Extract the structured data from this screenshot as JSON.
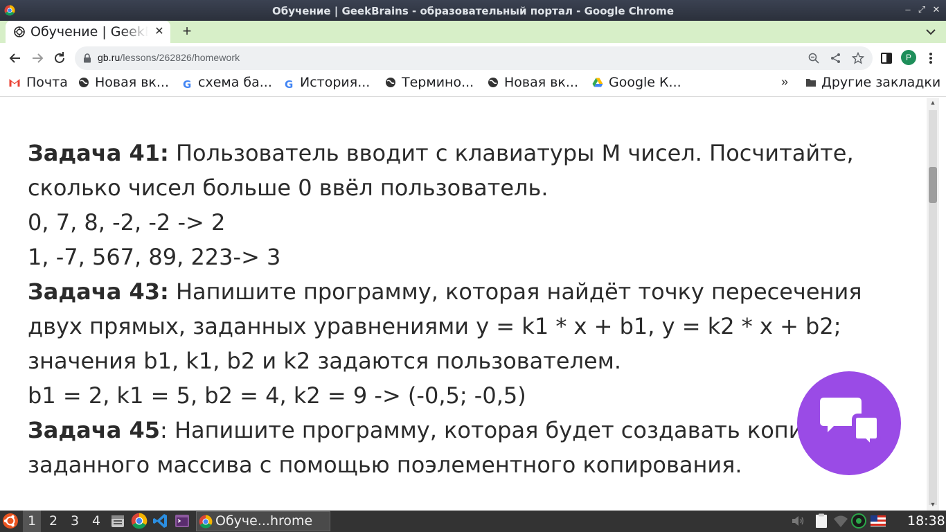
{
  "window": {
    "title": "Обучение | GeekBrains - образовательный портал - Google Chrome"
  },
  "tab": {
    "title": "Обучение | GeekBrains",
    "close_label": "✕",
    "new_tab_label": "+"
  },
  "omnibox": {
    "host": "gb.ru",
    "path": "/lessons/262826/homework"
  },
  "profile": {
    "initial": "P",
    "color": "#1e8e5a"
  },
  "bookmarks": {
    "items": [
      {
        "label": "Почта",
        "icon": "gmail-icon"
      },
      {
        "label": "Новая вк...",
        "icon": "globe-icon"
      },
      {
        "label": "схема ба...",
        "icon": "google-icon"
      },
      {
        "label": "История...",
        "icon": "google-icon"
      },
      {
        "label": "Термино...",
        "icon": "globe-icon"
      },
      {
        "label": "Новая вк...",
        "icon": "globe-icon"
      },
      {
        "label": "Google К...",
        "icon": "drive-icon"
      }
    ],
    "more_label": "»",
    "other_label": "Другие закладки"
  },
  "content": {
    "task41": {
      "label": "Задача 41:",
      "text": " Пользователь вводит с клавиатуры M чисел. Посчитайте, сколько чисел больше 0 ввёл пользователь."
    },
    "example41_1": "0, 7, 8, -2, -2 -> 2",
    "example41_2": "1, -7, 567, 89, 223-> 3",
    "task43": {
      "label": "Задача 43:",
      "text": " Напишите программу, которая найдёт точку пересечения двух прямых, заданных уравнениями y = k1 * x + b1, y = k2 * x + b2; значения b1, k1, b2 и k2 задаются пользователем."
    },
    "example43_1": "b1 = 2, k1 = 5, b2 = 4, k2 = 9 -> (-0,5; -0,5)",
    "task45": {
      "label": "Задача 45",
      "text": ": Напишите программу, которая будет создавать копию заданного массива с помощью поэлементного копирования."
    }
  },
  "colors": {
    "tabstrip": "#d7efc8",
    "chat_fab": "#9a4be6",
    "taskbar": "#333333"
  },
  "taskbar": {
    "workspaces": [
      "1",
      "2",
      "3",
      "4"
    ],
    "active_workspace": "1",
    "window_label": "Обуче...hrome",
    "clock": "18:38"
  }
}
